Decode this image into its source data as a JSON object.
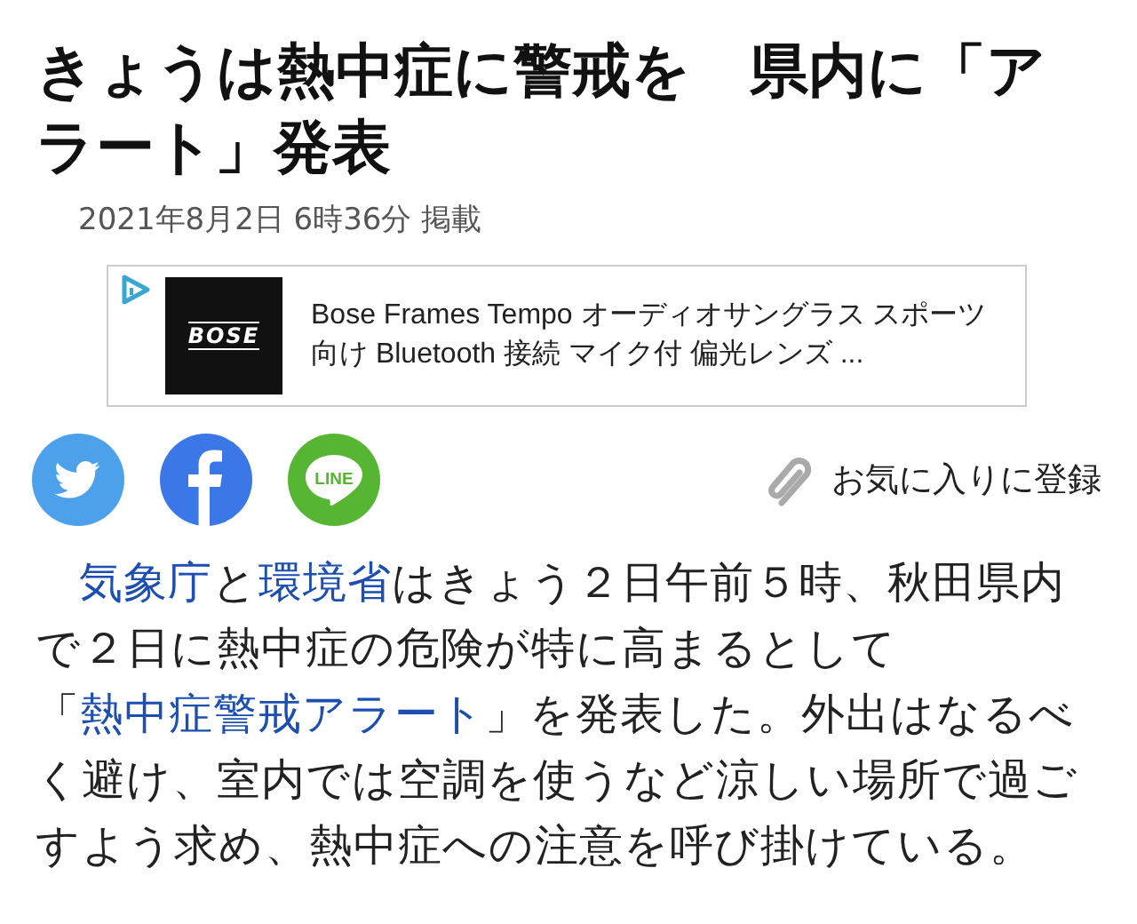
{
  "headline": "きょうは熱中症に警戒を　県内に「アラート」発表",
  "date": "2021年8月2日 6時36分 掲載",
  "ad": {
    "logo_text": "BOSE",
    "text": "Bose Frames Tempo オーディオサングラス スポーツ向け Bluetooth 接続 マイク付 偏光レンズ ..."
  },
  "share": {
    "line_label": "LINE",
    "favorite": "お気に入りに登録"
  },
  "body": [
    {
      "text": "気象庁",
      "link": true
    },
    {
      "text": "と",
      "link": false
    },
    {
      "text": "環境省",
      "link": true
    },
    {
      "text": "はきょう２日午前５時、秋田県内で２日に熱中症の危険が特に高まるとして「",
      "link": false
    },
    {
      "text": "熱中症警戒アラート",
      "link": true
    },
    {
      "text": "」を発表した。外出はなるべく避け、室内では空調を使うなど涼しい場所で過ごすよう求め、熱中症への注意を呼び掛けている。",
      "link": false
    }
  ]
}
